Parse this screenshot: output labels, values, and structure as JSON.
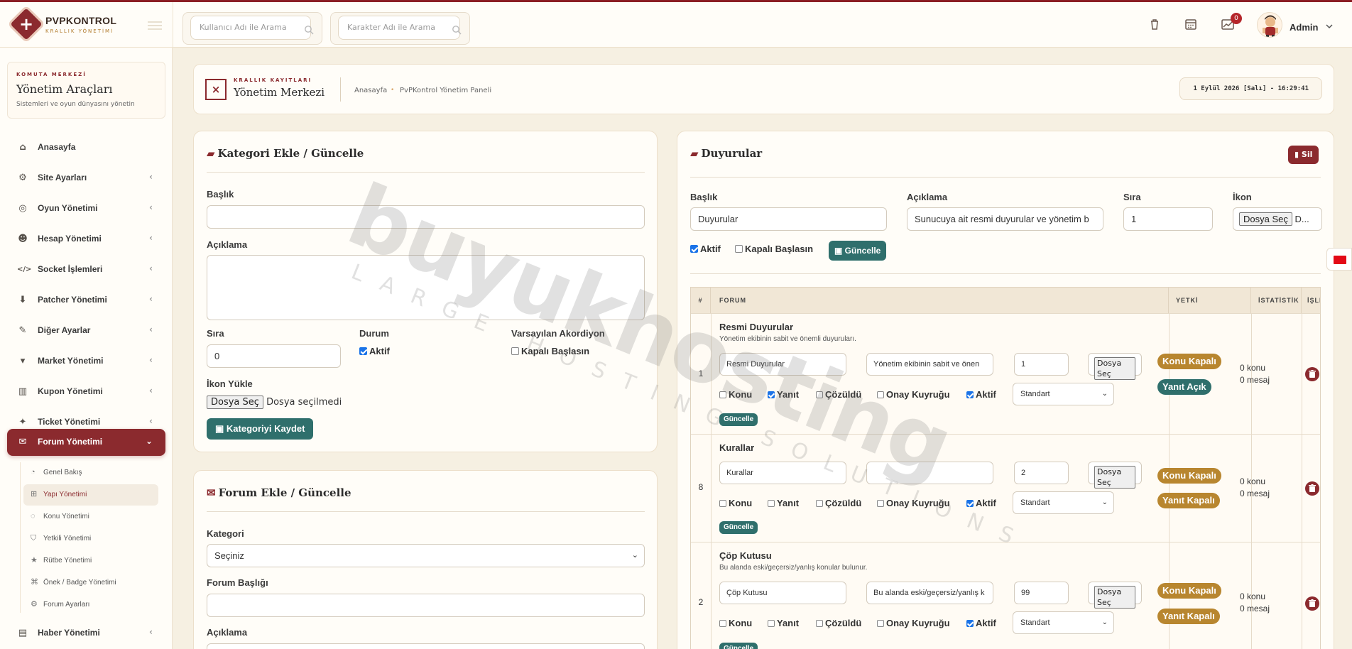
{
  "app": {
    "title": "PVPKONTROL",
    "subtitle": "KRALLIK YÖNETİMİ"
  },
  "search": {
    "user_placeholder": "Kullanıcı Adı ile Arama",
    "char_placeholder": "Karakter Adı ile Arama"
  },
  "topbar": {
    "notification_count": "0",
    "user_name": "Admin",
    "icons": [
      "trash-icon",
      "calendar-icon",
      "chart-icon"
    ]
  },
  "sidebar": {
    "eyebrow": "KOMUTA MERKEZİ",
    "title": "Yönetim Araçları",
    "desc": "Sistemleri ve oyun dünyasını yönetin",
    "items": [
      {
        "label": "Anasayfa",
        "icon": "home-icon"
      },
      {
        "label": "Site Ayarları",
        "icon": "gear-icon"
      },
      {
        "label": "Oyun Yönetimi",
        "icon": "gamepad-icon"
      },
      {
        "label": "Hesap Yönetimi",
        "icon": "users-icon"
      },
      {
        "label": "Socket İşlemleri",
        "icon": "code-icon"
      },
      {
        "label": "Patcher Yönetimi",
        "icon": "download-icon"
      },
      {
        "label": "Diğer Ayarlar",
        "icon": "wrench-icon"
      },
      {
        "label": "Market Yönetimi",
        "icon": "cart-icon"
      },
      {
        "label": "Kupon Yönetimi",
        "icon": "barcode-icon"
      },
      {
        "label": "Ticket Yönetimi",
        "icon": "ticket-icon"
      },
      {
        "label": "Forum Yönetimi",
        "icon": "comments-icon"
      }
    ],
    "sub_items": [
      {
        "label": "Genel Bakış"
      },
      {
        "label": "Yapı Yönetimi"
      },
      {
        "label": "Konu Yönetimi"
      },
      {
        "label": "Yetkili Yönetimi"
      },
      {
        "label": "Rütbe Yönetimi"
      },
      {
        "label": "Önek / Badge Yönetimi"
      },
      {
        "label": "Forum Ayarları"
      }
    ],
    "last_item": "Haber Yönetimi"
  },
  "pagehead": {
    "eyebrow": "KRALLIK KAYITLARI",
    "title": "Yönetim Merkezi",
    "breadcrumb_home": "Anasayfa",
    "breadcrumb_current": "PvPKontrol Yönetim Paneli",
    "datetime": "1 Eylül 2026 [Salı] - 16:29:41"
  },
  "category_form": {
    "title": "Kategori Ekle / Güncelle",
    "title_label": "Başlık",
    "desc_label": "Açıklama",
    "order_label": "Sıra",
    "order_value": "0",
    "status_label": "Durum",
    "status_check": "Aktif",
    "accordion_label": "Varsayılan Akordiyon",
    "accordion_check": "Kapalı Başlasın",
    "icon_label": "İkon Yükle",
    "file_button": "Dosya Seç",
    "file_status": "Dosya seçilmedi",
    "save_button": "Kategoriyi Kaydet"
  },
  "forum_form": {
    "title": "Forum Ekle / Güncelle",
    "category_label": "Kategori",
    "category_value": "Seçiniz",
    "forum_title_label": "Forum Başlığı",
    "desc_label": "Açıklama"
  },
  "announcements": {
    "title": "Duyurular",
    "delete_button": "Sil",
    "title_label": "Başlık",
    "title_value": "Duyurular",
    "desc_label": "Açıklama",
    "desc_value": "Sunucuya ait resmi duyurular ve yönetim b",
    "order_label": "Sıra",
    "order_value": "1",
    "icon_label": "İkon",
    "file_button": "Dosya Seç",
    "file_rest": "D...",
    "active_check": "Aktif",
    "closed_check": "Kapalı Başlasın",
    "update_button": "Güncelle"
  },
  "table": {
    "headers": {
      "num": "#",
      "forum": "FORUM",
      "perm": "YETKİ",
      "stats": "İSTATİSTİK",
      "action": "İŞLEM"
    },
    "check_labels": {
      "konu": "Konu",
      "yanit": "Yanıt",
      "cozuldu": "Çözüldü",
      "onay": "Onay Kuyruğu",
      "aktif": "Aktif"
    },
    "rows": [
      {
        "num": "1",
        "title": "Resmi Duyurular",
        "desc": "Yönetim ekibinin sabit ve önemli duyuruları.",
        "name_value": "Resmi Duyurular",
        "desc_value": "Yönetim ekibinin sabit ve önen",
        "order_value": "1",
        "file_button": "Dosya Seç",
        "select_value": "Standart",
        "update_button": "Güncelle",
        "pill1": "Konu Kapalı",
        "pill2": "Yanıt Açık",
        "stat1": "0 konu",
        "stat2": "0 mesaj"
      },
      {
        "num": "8",
        "title": "Kurallar",
        "desc": "",
        "name_value": "Kurallar",
        "desc_value": "",
        "order_value": "2",
        "file_button": "Dosya Seç",
        "select_value": "Standart",
        "update_button": "Güncelle",
        "pill1": "Konu Kapalı",
        "pill2": "Yanıt Kapalı",
        "stat1": "0 konu",
        "stat2": "0 mesaj"
      },
      {
        "num": "2",
        "title": "Çöp Kutusu",
        "desc": "Bu alanda eski/geçersiz/yanlış konular bulunur.",
        "name_value": "Çöp Kutusu",
        "desc_value": "Bu alanda eski/geçersiz/yanlış k",
        "order_value": "99",
        "file_button": "Dosya Seç",
        "select_value": "Standart",
        "update_button": "Güncelle",
        "pill1": "Konu Kapalı",
        "pill2": "Yanıt Kapalı",
        "stat1": "0 konu",
        "stat2": "0 mesaj"
      }
    ]
  },
  "watermark": {
    "main": "buyukhosting",
    "sub": "LARGE HOSTING SOLUTIONS"
  },
  "colors": {
    "brand": "#8b2a2e",
    "teal": "#2f6f6c",
    "gold": "#b8862f",
    "background": "#f6f0e2"
  }
}
